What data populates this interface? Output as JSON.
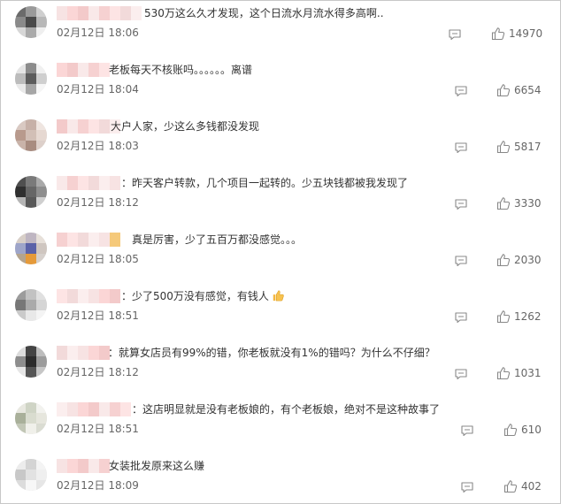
{
  "comments": [
    {
      "text": "530万这么久才发现，这个日流水月流水得多高啊..",
      "time": "02月12日 18:06",
      "likes": "14970"
    },
    {
      "text": "老板每天不核账吗。。。。。。离谱",
      "time": "02月12日 18:04",
      "likes": "6654"
    },
    {
      "text": "大户人家，少这么多钱都没发现",
      "time": "02月12日 18:03",
      "likes": "5817"
    },
    {
      "text": "：昨天客户转款，几个项目一起转的。少五块钱都被我发现了",
      "time": "02月12日 18:12",
      "likes": "3330"
    },
    {
      "text": "真是厉害，少了五百万都没感觉。。。",
      "time": "02月12日 18:05",
      "likes": "2030"
    },
    {
      "text": "：少了500万没有感觉，有钱人",
      "time": "02月12日 18:51",
      "likes": "1262"
    },
    {
      "text": "：就算女店员有99%的错，你老板就没有1%的错吗？为什么不仔细？",
      "time": "02月12日 18:12",
      "likes": "1031"
    },
    {
      "text": "：这店明显就是没有老板娘的，有个老板娘，绝对不是这种故事了",
      "time": "02月12日 18:51",
      "likes": "610"
    },
    {
      "text": "女装批发原来这么赚",
      "time": "02月12日 18:09",
      "likes": "402"
    }
  ],
  "icons": {
    "reply": "comment-icon",
    "like": "thumbs-up-icon",
    "emoji": "thumbs-up-emoji"
  },
  "colors": {
    "text": "#333333",
    "meta": "#666666",
    "icon": "#888888",
    "border": "#c8c8c8"
  }
}
